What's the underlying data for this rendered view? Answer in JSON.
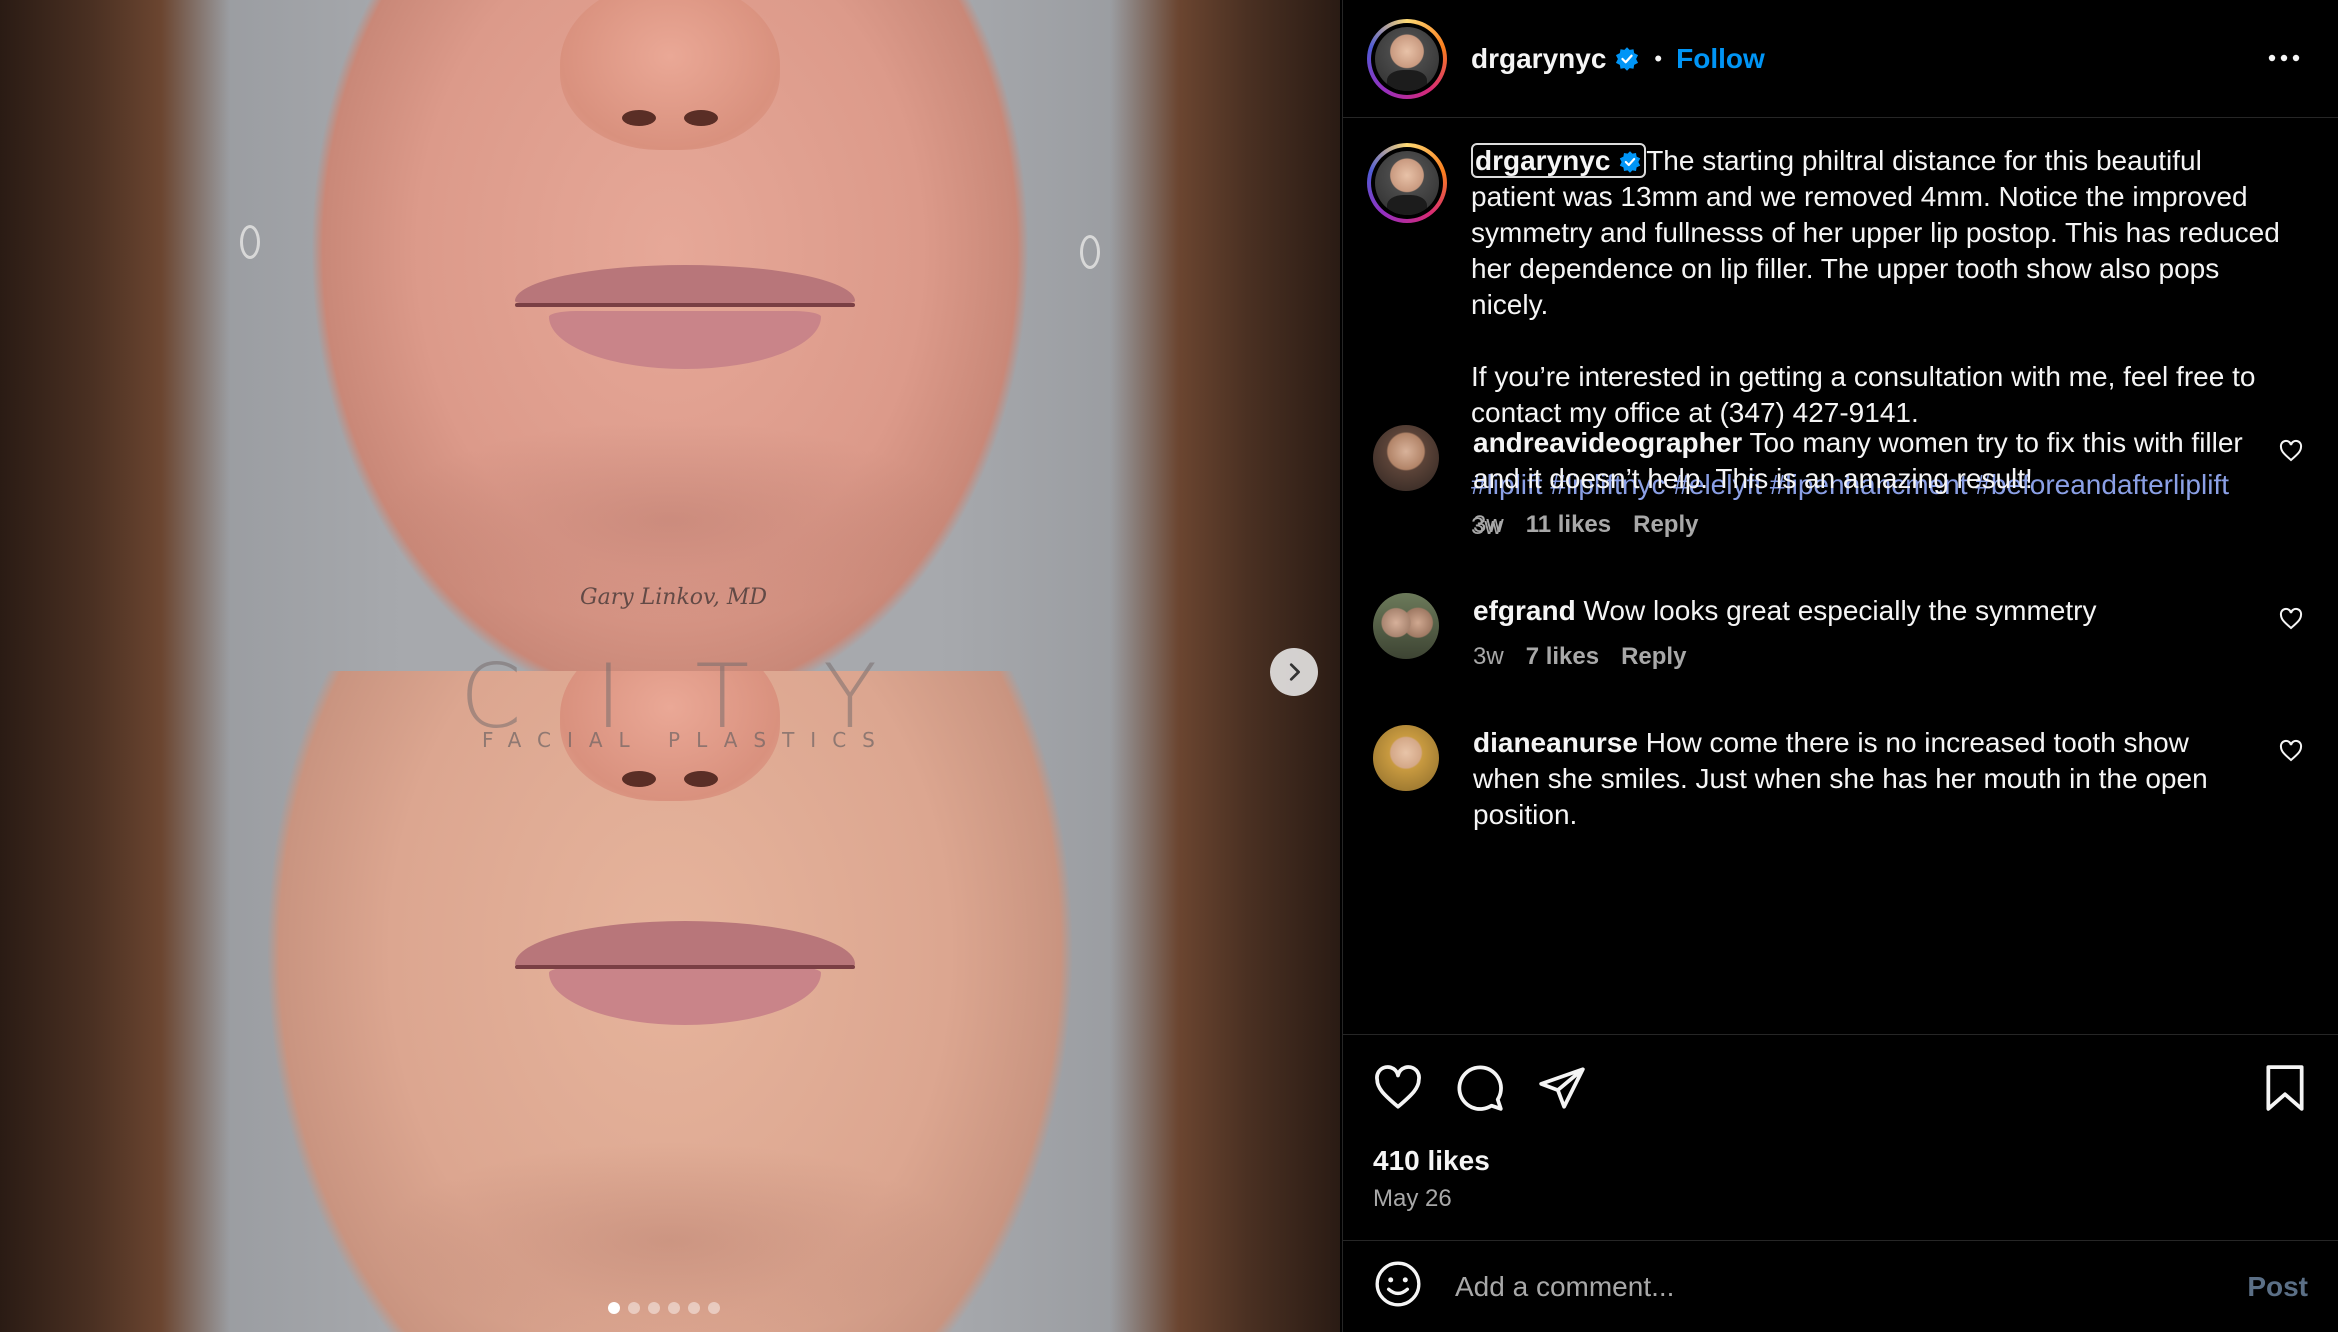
{
  "media": {
    "watermark": {
      "signature": "Gary Linkov, MD",
      "brand": "CITY",
      "subtitle": "FACIAL PLASTICS"
    },
    "carousel": {
      "slide_count": 6,
      "active_index": 0,
      "next_icon": "chevron-right-icon"
    }
  },
  "header": {
    "username": "drgarynyc",
    "verified_icon": "verified-badge-icon",
    "separator": "•",
    "follow_label": "Follow",
    "more_icon": "more-horizontal-icon"
  },
  "caption": {
    "username": "drgarynyc",
    "text_1": "The starting philtral distance for this beautiful patient was 13mm and we removed 4mm. Notice the improved symmetry and fullnesss of her upper lip postop. This has reduced her dependence on lip filler. The upper tooth show also pops nicely.",
    "text_2": "If you’re interested in getting a consultation with me, feel free to contact my office at (347) 427-9141.",
    "hashtags": "#liplift #lipliftnyc #elelyft #lipenhancment #beforeandafterliplift",
    "time": "3w"
  },
  "comments": [
    {
      "username": "andreavideographer",
      "text": "Too many women try to fix this with filler and it doesn’t help. This is an amazing result!",
      "time": "3w",
      "likes": "11 likes",
      "reply": "Reply"
    },
    {
      "username": "efgrand",
      "text": "Wow looks great especially the symmetry",
      "time": "3w",
      "likes": "7 likes",
      "reply": "Reply"
    },
    {
      "username": "dianeanurse",
      "text": "How come there is no increased tooth show when she smiles. Just when she has her mouth in the open position."
    }
  ],
  "actions": {
    "like_icon": "heart-icon",
    "comment_icon": "comment-icon",
    "share_icon": "share-icon",
    "save_icon": "bookmark-icon",
    "likes": "410 likes",
    "date": "May 26"
  },
  "add_comment": {
    "emoji_icon": "emoji-icon",
    "placeholder": "Add a comment...",
    "post_label": "Post"
  },
  "colors": {
    "background": "#000000",
    "link_blue": "#0095f6",
    "hashtag": "#8ba0e6",
    "secondary_text": "#a8a8a8",
    "divider": "#262626"
  }
}
